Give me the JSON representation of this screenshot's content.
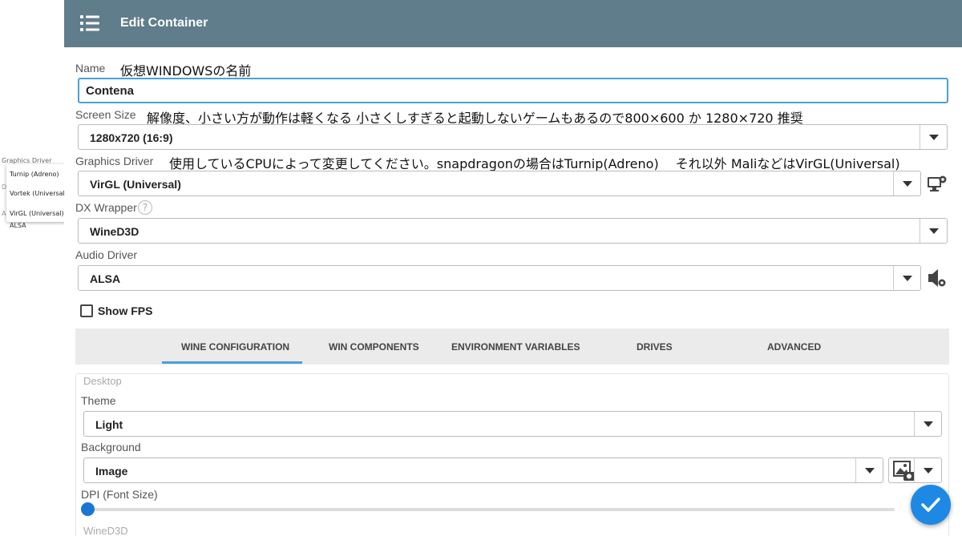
{
  "inset": {
    "label": "Graphics Driver",
    "clipped_letters": [
      "D",
      "A"
    ],
    "options": [
      "Turnip (Adreno)",
      "Vortek (Universal)",
      "VirGL (Universal)"
    ],
    "audio_value": "ALSA"
  },
  "appbar": {
    "title": "Edit Container",
    "menu_icon": "hamburger-icon"
  },
  "name": {
    "label": "Name",
    "note": "仮想WINDOWSの名前",
    "value": "Contena"
  },
  "screen_size": {
    "label": "Screen Size",
    "note": "解像度、小さい方が動作は軽くなる 小さくしすぎると起動しないゲームもあるので800×600 か 1280×720 推奨",
    "value": "1280x720 (16:9)"
  },
  "graphics_driver": {
    "label": "Graphics Driver",
    "note": "使用しているCPUによって変更してください。snapdragonの場合はTurnip(Adreno)　 それ以外 MaliなどはVirGL(Universal)",
    "value": "VirGL (Universal)",
    "settings_icon": "monitor-gear-icon"
  },
  "dx_wrapper": {
    "label": "DX Wrapper",
    "help": "?",
    "value": "WineD3D"
  },
  "audio_driver": {
    "label": "Audio Driver",
    "value": "ALSA",
    "settings_icon": "speaker-gear-icon"
  },
  "show_fps": {
    "label": "Show FPS",
    "checked": false
  },
  "tabs": [
    {
      "label": "WINE CONFIGURATION",
      "active": true
    },
    {
      "label": "WIN COMPONENTS",
      "active": false
    },
    {
      "label": "ENVIRONMENT VARIABLES",
      "active": false
    },
    {
      "label": "DRIVES",
      "active": false
    },
    {
      "label": "ADVANCED",
      "active": false
    }
  ],
  "desktop": {
    "legend": "Desktop",
    "theme_label": "Theme",
    "theme_value": "Light",
    "background_label": "Background",
    "background_value": "Image",
    "dpi_label": "DPI (Font Size)",
    "dpi_value": 0
  },
  "wined3d_legend": "WineD3D",
  "colors": {
    "appbar": "#607d8b",
    "accent": "#4aa0d5",
    "fab": "#1e88e5"
  }
}
